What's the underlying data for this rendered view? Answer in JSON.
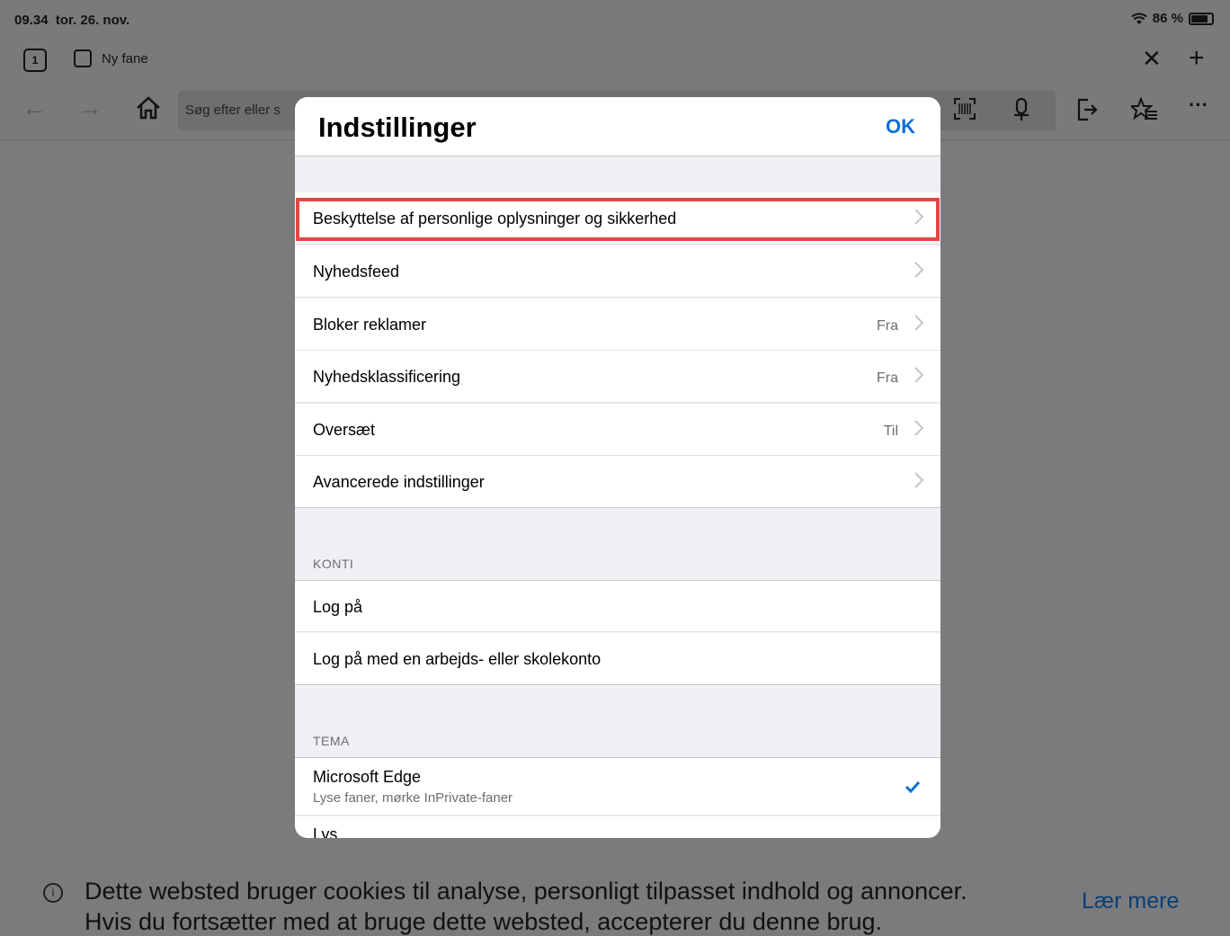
{
  "status": {
    "time": "09.34",
    "date": "tor. 26. nov.",
    "battery": "86 %"
  },
  "tabbar": {
    "tab_count": "1",
    "tab_title": "Ny fane"
  },
  "toolbar": {
    "address_placeholder": "Søg efter eller s"
  },
  "settings": {
    "title": "Indstillinger",
    "ok": "OK",
    "items": [
      {
        "label": "Beskyttelse af personlige oplysninger og sikkerhed",
        "value": ""
      },
      {
        "label": "Nyhedsfeed",
        "value": ""
      },
      {
        "label": "Bloker reklamer",
        "value": "Fra"
      },
      {
        "label": "Nyhedsklassificering",
        "value": "Fra"
      },
      {
        "label": "Oversæt",
        "value": "Til"
      },
      {
        "label": "Avancerede indstillinger",
        "value": ""
      }
    ],
    "accounts_header": "KONTI",
    "accounts": [
      {
        "label": "Log på"
      },
      {
        "label": "Log på med en arbejds- eller skolekonto"
      }
    ],
    "theme_header": "TEMA",
    "theme_selected": {
      "label": "Microsoft Edge",
      "sub": "Lyse faner, mørke InPrivate-faner"
    },
    "theme_next": {
      "label": "Lys"
    }
  },
  "cookie": {
    "line1": "Dette websted bruger cookies til analyse, personligt tilpasset indhold og annoncer.",
    "line2": "Hvis du fortsætter med at bruge dette websted, accepterer du denne brug.",
    "learn_more": "Lær mere"
  },
  "colors": {
    "accent": "#0a6fd6",
    "highlight": "#e64545"
  }
}
